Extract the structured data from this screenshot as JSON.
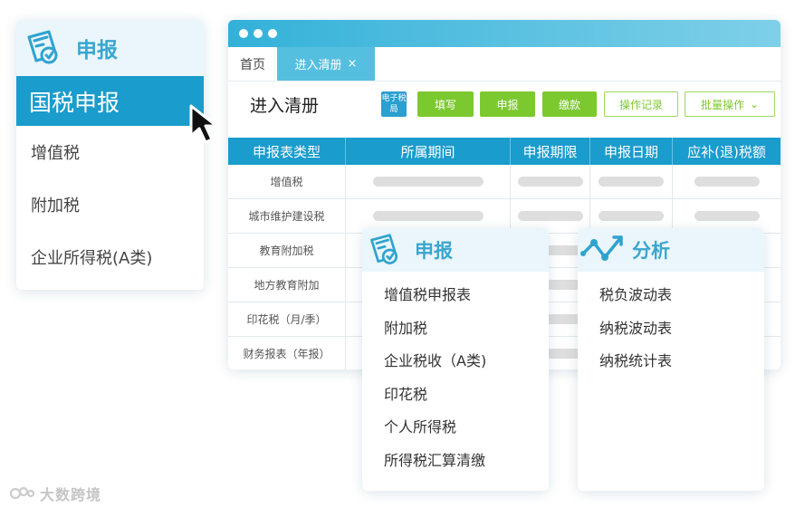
{
  "left_panel": {
    "title": "申报",
    "active_item": "国税申报",
    "items": [
      "增值税",
      "附加税",
      "企业所得税(A类)"
    ]
  },
  "window": {
    "tabs": {
      "home": "首页",
      "active": "进入清册",
      "close": "×"
    },
    "page_title": "进入清册",
    "etax_badge": "电子税局",
    "buttons": {
      "fill": "填写",
      "declare": "申报",
      "pay": "缴款",
      "log": "操作记录",
      "batch": "批量操作",
      "batch_arrow": "⌄"
    },
    "table": {
      "headers": [
        "申报表类型",
        "所属期间",
        "申报期限",
        "申报日期",
        "应补(退)税额"
      ],
      "rows": [
        "增值税",
        "城市维护建设税",
        "教育附加税",
        "地方教育附加",
        "印花税（月/季）",
        "财务报表（年报）"
      ]
    }
  },
  "popup_report": {
    "title": "申报",
    "items": [
      "增值税申报表",
      "附加税",
      "企业税收（A类)",
      "印花税",
      "个人所得税",
      "所得税汇算清缴"
    ]
  },
  "popup_analysis": {
    "title": "分析",
    "items": [
      "税负波动表",
      "纳税波动表",
      "纳税统计表"
    ]
  },
  "watermark": {
    "text": "大数跨境"
  },
  "colors": {
    "primary": "#1a9ccc",
    "accent_green": "#7cc92f",
    "light_header": "#eaf6fb"
  }
}
